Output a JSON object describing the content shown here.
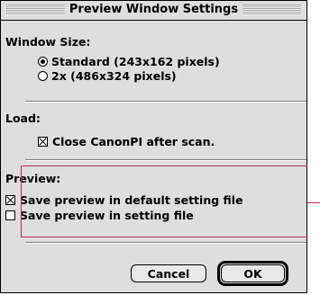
{
  "dialog": {
    "title": "Preview Window Settings"
  },
  "window_size": {
    "label": "Window Size:",
    "options": [
      {
        "label": "Standard (243x162 pixels)",
        "selected": true
      },
      {
        "label": "2x (486x324 pixels)",
        "selected": false
      }
    ]
  },
  "load": {
    "label": "Load:",
    "close_canonpi": {
      "label": "Close CanonPI after scan.",
      "checked": true
    }
  },
  "preview": {
    "label": "Preview:",
    "save_default": {
      "label": "Save preview in default setting file",
      "checked": true
    },
    "save_setting": {
      "label": "Save preview in setting file",
      "checked": false
    }
  },
  "buttons": {
    "cancel": "Cancel",
    "ok": "OK"
  },
  "colors": {
    "dialog_bg": "#dedede",
    "highlight": "#b03060"
  }
}
